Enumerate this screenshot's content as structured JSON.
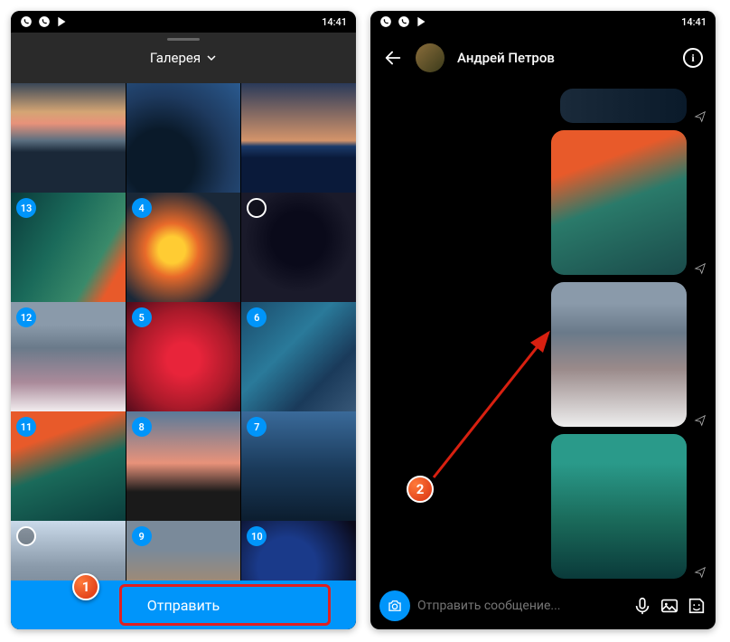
{
  "statusbar": {
    "time": "14:41"
  },
  "gallery": {
    "title": "Галерея",
    "send_label": "Отправить",
    "thumbs": [
      {
        "selected": false
      },
      {
        "selected": false
      },
      {
        "selected": false
      },
      {
        "selected": true,
        "order": 13
      },
      {
        "selected": true,
        "order": 4
      },
      {
        "selected_empty": true
      },
      {
        "selected": true,
        "order": 12
      },
      {
        "selected": true,
        "order": 5
      },
      {
        "selected": true,
        "order": 6
      },
      {
        "selected": true,
        "order": 11
      },
      {
        "selected": true,
        "order": 8
      },
      {
        "selected": true,
        "order": 7
      },
      {
        "selected_empty": true
      },
      {
        "selected": true,
        "order": 9
      },
      {
        "selected": true,
        "order": 10
      }
    ]
  },
  "chat": {
    "contact_name": "Андрей Петров",
    "input_placeholder": "Отправить сообщение..."
  },
  "steps": {
    "one": "1",
    "two": "2"
  }
}
